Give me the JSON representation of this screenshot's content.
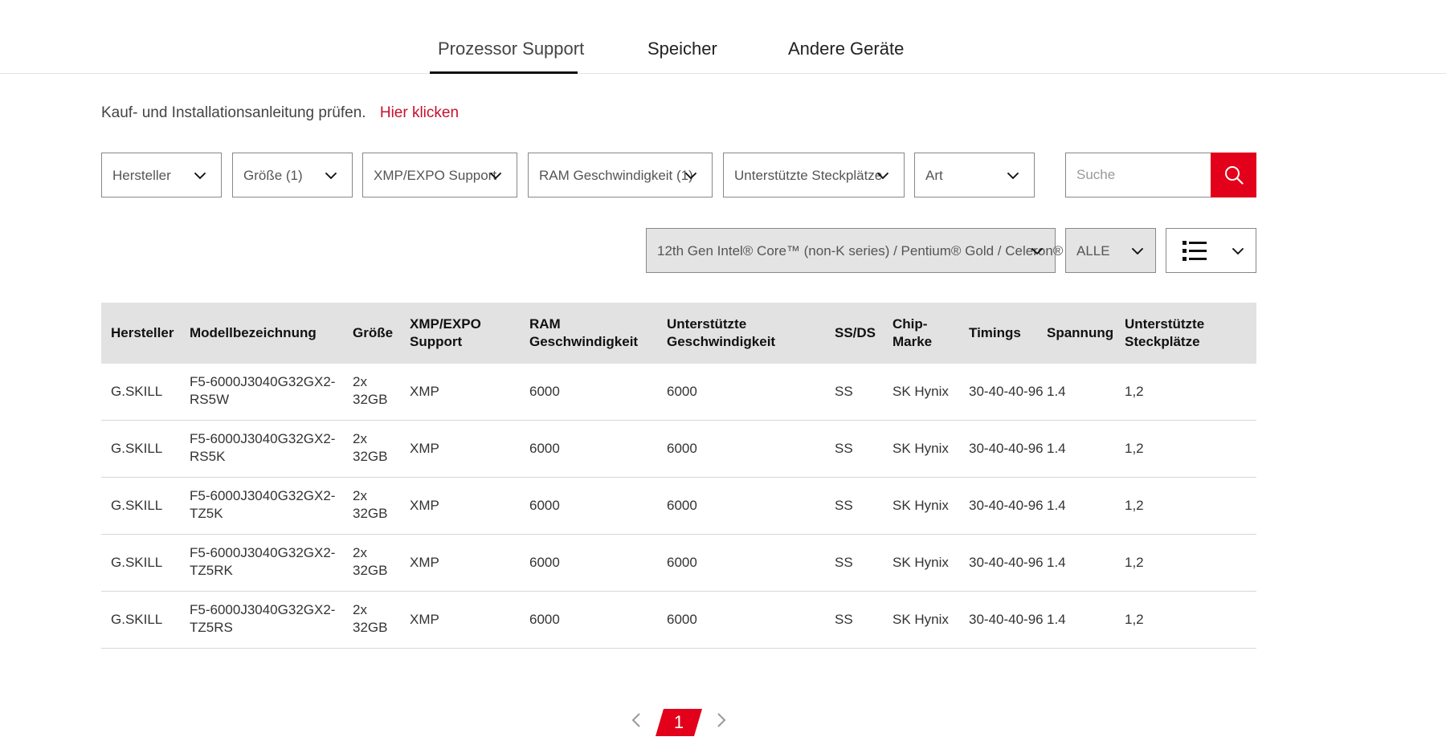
{
  "tabs": [
    {
      "label": "Prozessor Support"
    },
    {
      "label": "Speicher"
    },
    {
      "label": "Andere Geräte"
    }
  ],
  "guide": {
    "text": "Kauf- und Installationsanleitung prüfen.",
    "link": "Hier klicken"
  },
  "filters": [
    {
      "label": "Hersteller"
    },
    {
      "label": "Größe (1)"
    },
    {
      "label": "XMP/EXPO Support"
    },
    {
      "label": "RAM Geschwindigkeit (1)"
    },
    {
      "label": "Unterstützte Steckplätze"
    },
    {
      "label": "Art"
    }
  ],
  "search": {
    "placeholder": "Suche"
  },
  "selectors": {
    "cpu": "12th Gen Intel® Core™ (non-K series) / Pentium® Gold / Celeron®",
    "scope": "ALLE"
  },
  "table": {
    "headers": [
      [
        "Hersteller"
      ],
      [
        "Modellbezeichnung"
      ],
      [
        "Größe"
      ],
      [
        "XMP/EXPO",
        "Support"
      ],
      [
        "RAM",
        "Geschwindigkeit"
      ],
      [
        "Unterstützte",
        "Geschwindigkeit"
      ],
      [
        "SS/DS"
      ],
      [
        "Chip-",
        "Marke"
      ],
      [
        "Timings"
      ],
      [
        "Spannung"
      ],
      [
        "Unterstützte",
        "Steckplätze"
      ]
    ],
    "rows": [
      {
        "brand": "G.SKILL",
        "model": [
          "F5-6000J3040G32GX2-",
          "RS5W"
        ],
        "size": [
          "2x",
          "32GB"
        ],
        "xmp": "XMP",
        "ram_speed": "6000",
        "supported_speed": "6000",
        "ssds": "SS",
        "chip": "SK Hynix",
        "timings": "30-40-40-96",
        "voltage": "1.4",
        "slots": "1,2"
      },
      {
        "brand": "G.SKILL",
        "model": [
          "F5-6000J3040G32GX2-",
          "RS5K"
        ],
        "size": [
          "2x",
          "32GB"
        ],
        "xmp": "XMP",
        "ram_speed": "6000",
        "supported_speed": "6000",
        "ssds": "SS",
        "chip": "SK Hynix",
        "timings": "30-40-40-96",
        "voltage": "1.4",
        "slots": "1,2"
      },
      {
        "brand": "G.SKILL",
        "model": [
          "F5-6000J3040G32GX2-",
          "TZ5K"
        ],
        "size": [
          "2x",
          "32GB"
        ],
        "xmp": "XMP",
        "ram_speed": "6000",
        "supported_speed": "6000",
        "ssds": "SS",
        "chip": "SK Hynix",
        "timings": "30-40-40-96",
        "voltage": "1.4",
        "slots": "1,2"
      },
      {
        "brand": "G.SKILL",
        "model": [
          "F5-6000J3040G32GX2-",
          "TZ5RK"
        ],
        "size": [
          "2x",
          "32GB"
        ],
        "xmp": "XMP",
        "ram_speed": "6000",
        "supported_speed": "6000",
        "ssds": "SS",
        "chip": "SK Hynix",
        "timings": "30-40-40-96",
        "voltage": "1.4",
        "slots": "1,2"
      },
      {
        "brand": "G.SKILL",
        "model": [
          "F5-6000J3040G32GX2-",
          "TZ5RS"
        ],
        "size": [
          "2x",
          "32GB"
        ],
        "xmp": "XMP",
        "ram_speed": "6000",
        "supported_speed": "6000",
        "ssds": "SS",
        "chip": "SK Hynix",
        "timings": "30-40-40-96",
        "voltage": "1.4",
        "slots": "1,2"
      }
    ]
  },
  "pagination": {
    "current": "1"
  },
  "colors": {
    "accent": "#e2001a",
    "link": "#c8102e",
    "header_bg": "#e2e2e2"
  },
  "icons": {
    "search": "search-icon",
    "dropdown": "chevron-down-icon",
    "view": "list-view-icon",
    "prev": "chevron-left-icon",
    "next": "chevron-right-icon"
  }
}
